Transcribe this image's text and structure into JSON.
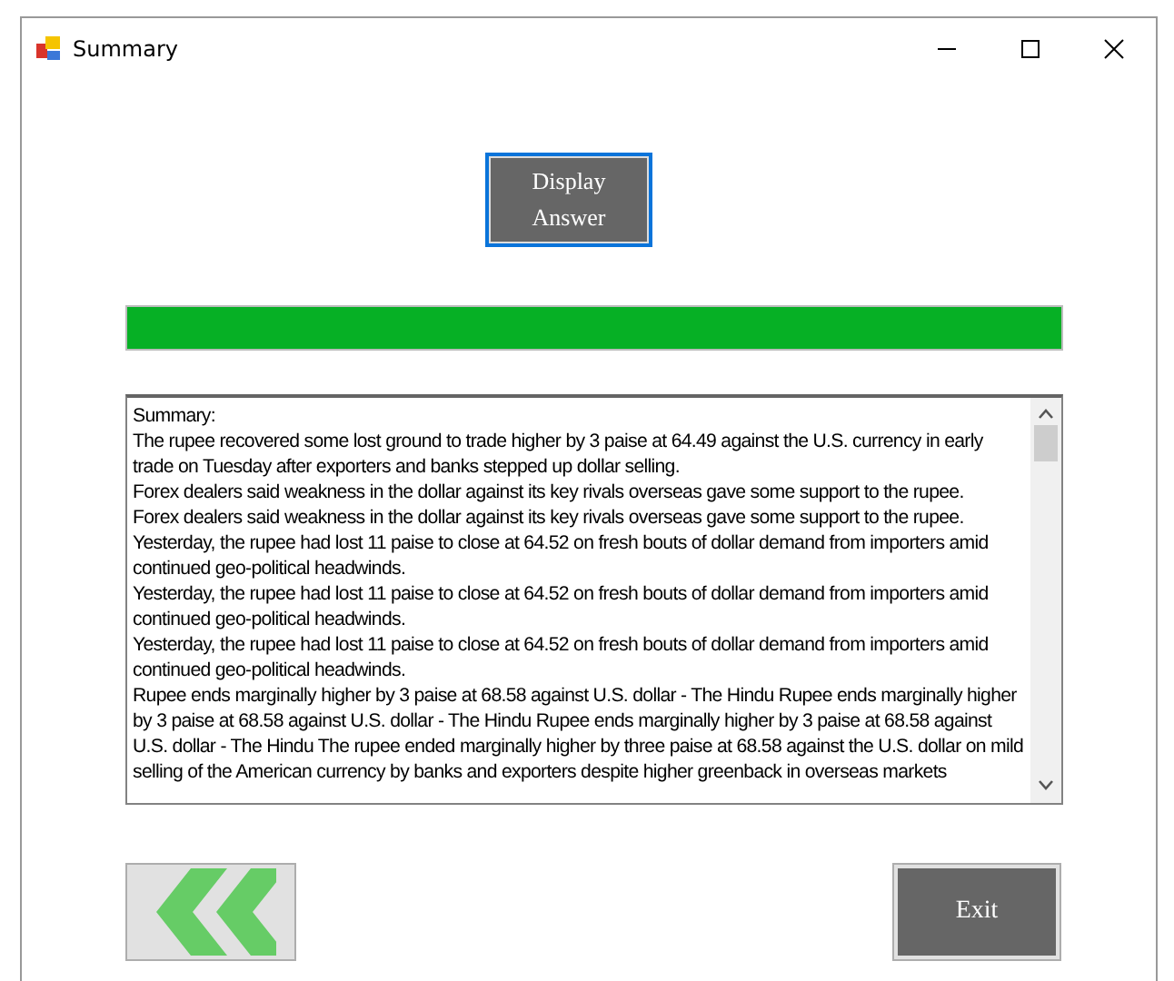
{
  "window": {
    "title": "Summary"
  },
  "display_button": {
    "label": "Display Answer",
    "focused": true
  },
  "progress": {
    "level": 1
  },
  "summary_text": [
    "Summary:",
    "The rupee recovered some lost ground to trade higher by 3 paise at 64.49 against the U.S. currency in early trade on Tuesday after exporters and banks stepped up dollar selling.",
    "Forex dealers said weakness in the dollar against its key rivals overseas gave some support to the rupee.",
    "Forex dealers said weakness in the dollar against its key rivals overseas gave some support to the rupee.",
    "Yesterday, the rupee had lost 11 paise to close at 64.52 on fresh bouts of dollar demand from importers amid continued geo-political headwinds.",
    "Yesterday, the rupee had lost 11 paise to close at 64.52 on fresh bouts of dollar demand from importers amid continued geo-political headwinds.",
    "Yesterday, the rupee had lost 11 paise to close at 64.52 on fresh bouts of dollar demand from importers amid continued geo-political headwinds.",
    "Rupee ends marginally higher by 3 paise at 68.58 against U.S. dollar - The Hindu Rupee ends marginally higher by 3 paise at 68.58 against U.S. dollar - The Hindu Rupee ends marginally higher by 3 paise at 68.58 against U.S. dollar - The Hindu The rupee ended marginally higher by three paise at 68.58 against the U.S. dollar on mild selling of the American currency by banks and exporters despite higher greenback in overseas markets"
  ],
  "exit_button": {
    "label": "Exit"
  }
}
